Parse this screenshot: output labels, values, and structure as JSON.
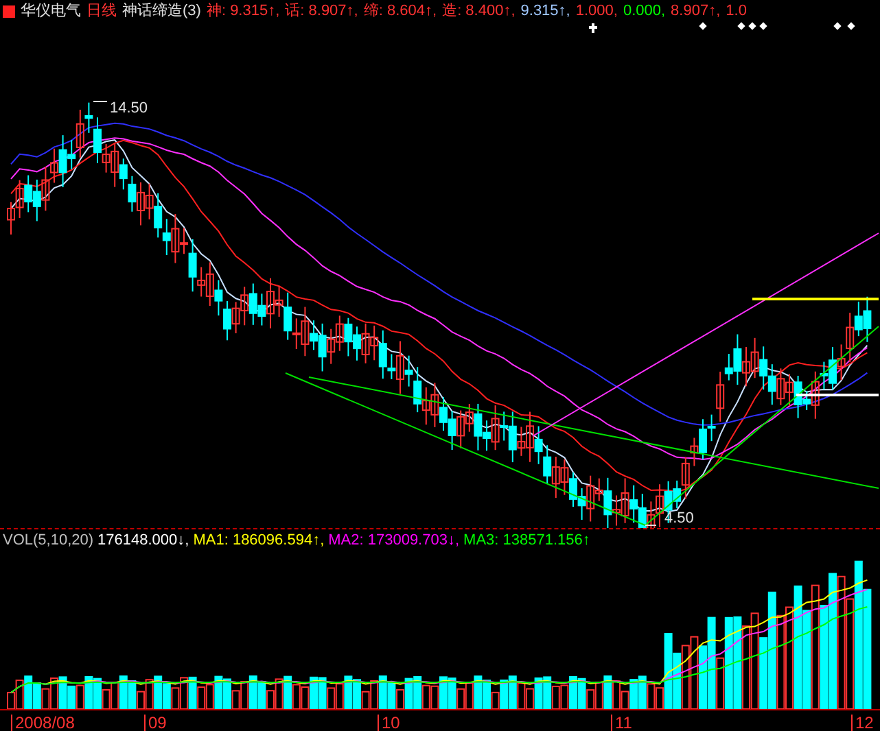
{
  "header": {
    "stock_name": "华仪电气",
    "period": "日线",
    "indicator": "神话缔造(3)",
    "values": [
      {
        "text": "神: 9.315↑,",
        "color": "#ff3232"
      },
      {
        "text": "话: 8.907↑,",
        "color": "#ff3232"
      },
      {
        "text": "缔: 8.604↑,",
        "color": "#ff3232"
      },
      {
        "text": "造: 8.400↑,",
        "color": "#ff3232"
      },
      {
        "text": "9.315↑,",
        "color": "#a0c8ff"
      },
      {
        "text": "1.000,",
        "color": "#ff3232"
      },
      {
        "text": "0.000,",
        "color": "#00ff00"
      },
      {
        "text": "8.907↑,",
        "color": "#ff3232"
      },
      {
        "text": "1.0",
        "color": "#ff3232"
      }
    ]
  },
  "chart": {
    "annotations": [
      {
        "text": "14.50"
      },
      {
        "text": "4.50"
      }
    ]
  },
  "volume": {
    "title": "VOL(5,10,20)",
    "values": [
      {
        "text": "176148.000↓,",
        "color": "#ffffff"
      },
      {
        "text": "MA1: 186096.594↑,",
        "color": "#ffff00"
      },
      {
        "text": "MA2: 173009.703↓,",
        "color": "#ff00ff"
      },
      {
        "text": "MA3: 138571.156↑",
        "color": "#00ff00"
      }
    ]
  },
  "axis": {
    "labels": [
      "2008/08",
      "09",
      "10",
      "11",
      "12"
    ]
  }
}
